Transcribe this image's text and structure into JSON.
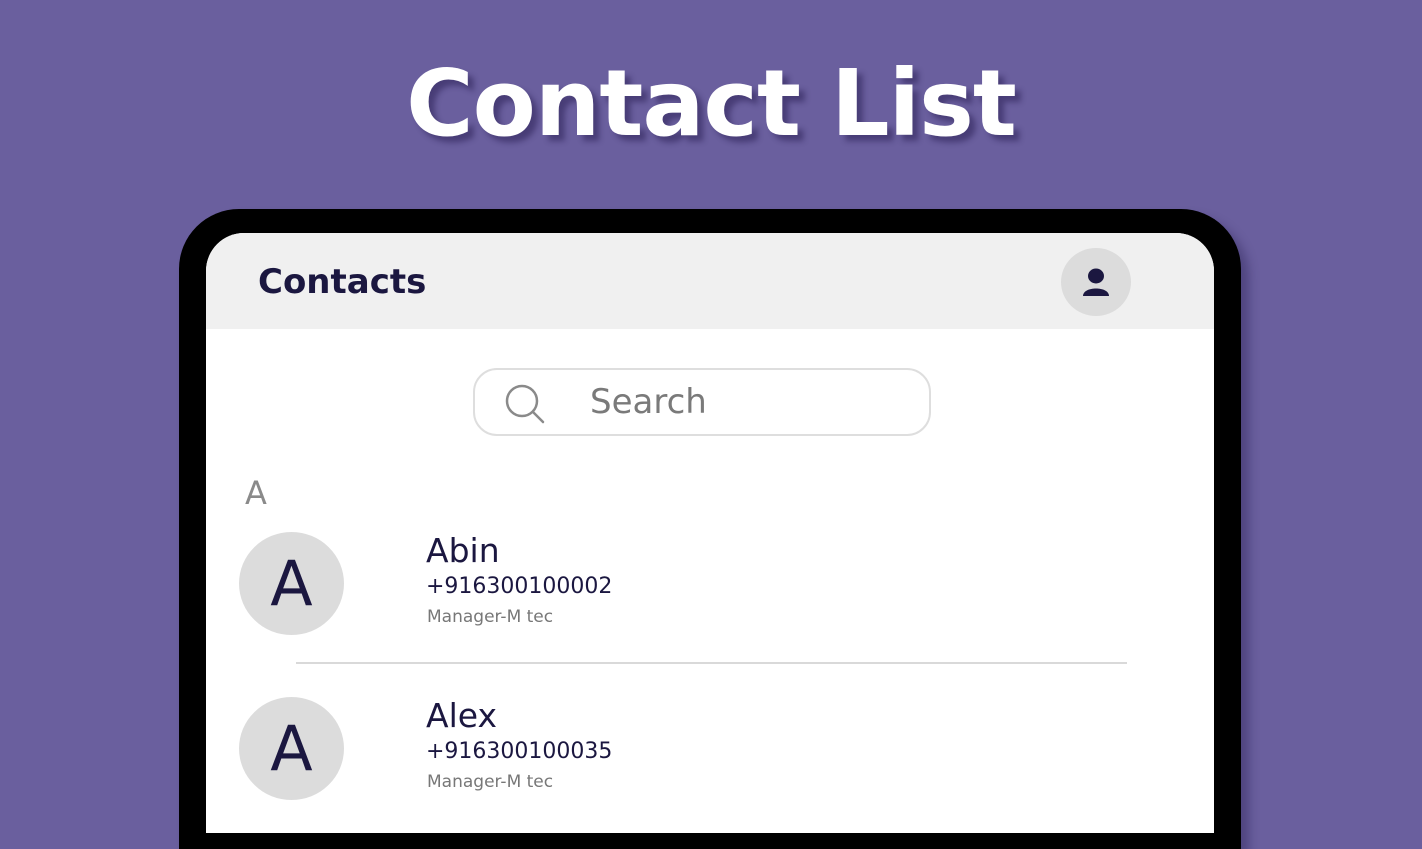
{
  "banner": {
    "title": "Contact List"
  },
  "appbar": {
    "title": "Contacts",
    "profile_icon": "person-icon"
  },
  "search": {
    "placeholder": "Search",
    "value": "",
    "icon": "search-icon"
  },
  "sections": [
    {
      "letter": "A",
      "contacts": [
        {
          "initial": "A",
          "name": "Abin",
          "phone": "+916300100002",
          "role": "Manager-M tec"
        },
        {
          "initial": "A",
          "name": "Alex",
          "phone": "+916300100035",
          "role": "Manager-M tec"
        }
      ]
    }
  ],
  "colors": {
    "background": "#6a5f9e",
    "appbar": "#f0f0f0",
    "text_primary": "#1b1740",
    "avatar_bg": "#dcdcdc"
  }
}
